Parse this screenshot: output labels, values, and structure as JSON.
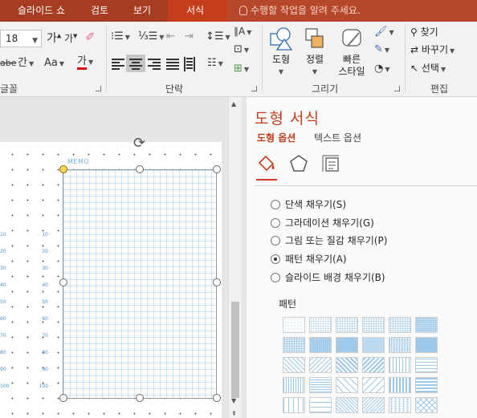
{
  "tabs": [
    {
      "label": "슬라이드 쇼"
    },
    {
      "label": "검토"
    },
    {
      "label": "보기"
    },
    {
      "label": "서식"
    }
  ],
  "tell_me": "수행할 작업을 알려 주세요.",
  "ribbon": {
    "font_size": "18",
    "groups": {
      "font": "글꼴",
      "paragraph": "단락",
      "drawing": "그리기",
      "editing": "편집"
    },
    "font_controls": {
      "grow": "가",
      "shrink": "가",
      "spacing": "간",
      "change_case": "Aa",
      "font_color": "가"
    },
    "drawing_buttons": {
      "shapes": "도형",
      "arrange": "정렬",
      "quick_styles_line1": "빠른",
      "quick_styles_line2": "스타일"
    },
    "editing_buttons": {
      "find": "찾기",
      "replace": "바꾸기",
      "select": "선택"
    }
  },
  "slide": {
    "memo_label": "MEMO",
    "numbers": [
      "10",
      "20",
      "30",
      "40",
      "50",
      "60",
      "70",
      "80",
      "90",
      "100"
    ]
  },
  "pane": {
    "title": "도형 서식",
    "tabs": {
      "shape_options": "도형 옵션",
      "text_options": "텍스트 옵션"
    },
    "fill_options": [
      {
        "label": "단색 채우기(S)",
        "checked": false
      },
      {
        "label": "그라데이션 채우기(G)",
        "checked": false
      },
      {
        "label": "그림 또는 질감 채우기(P)",
        "checked": false
      },
      {
        "label": "패턴 채우기(A)",
        "checked": true
      },
      {
        "label": "슬라이드 배경 채우기(B)",
        "checked": false
      }
    ],
    "pattern_label": "패턴",
    "accent_color": "#c43e1c",
    "pattern_color": "#9ec8ea"
  }
}
